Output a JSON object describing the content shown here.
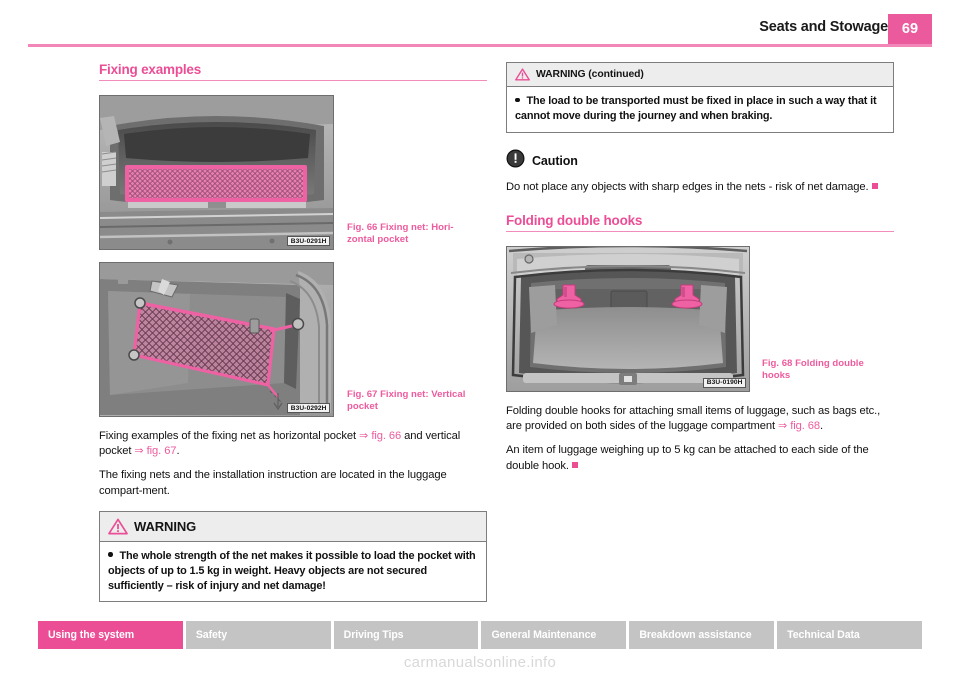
{
  "header": {
    "title": "Seats and Stowage",
    "page_number": "69",
    "accent_color": "#ec4e96"
  },
  "left_column": {
    "heading": "Fixing examples",
    "figures": [
      {
        "label": "Fig. 66",
        "caption": "Fixing net: Hori-\nzontal pocket",
        "caption_line1": "Fixing net: Hori-",
        "caption_line2": "zontal pocket",
        "watermark": "B3U-0291H",
        "alt": "Open car boot with pink fixing net stretched horizontally as a pocket"
      },
      {
        "label": "Fig. 67",
        "caption_line1": "Fixing net:",
        "caption_line2": "Vertical pocket",
        "watermark": "B3U-0292H",
        "alt": "Luggage compartment side wall with pink fixing net mounted as a vertical pocket"
      }
    ],
    "paragraphs": [
      {
        "segments": [
          {
            "text": "Fixing examples of the fixing net as horizontal pocket ",
            "style": "plain"
          },
          {
            "text": "⇒ fig. 66",
            "style": "xref"
          },
          {
            "text": " and vertical pocket ",
            "style": "plain"
          },
          {
            "text": "⇒ fig. 67",
            "style": "xref"
          },
          {
            "text": ".",
            "style": "plain"
          }
        ]
      },
      {
        "segments": [
          {
            "text": "The fixing nets and the installation instruction are located in the luggage compart-ment.",
            "style": "plain"
          }
        ]
      }
    ],
    "warning": {
      "icon": "warning-triangle-icon",
      "title": "WARNING",
      "bullet": "The whole strength of the net makes it possible to load the pocket with objects of up to 1.5 kg in weight. Heavy objects are not secured sufficiently – risk of injury and net damage!"
    }
  },
  "right_column": {
    "warning_continued": {
      "icon": "warning-triangle-icon",
      "title": "WARNING (continued)",
      "bullet": "The load to be transported must be fixed in place in such a way that it cannot move during the journey and when braking."
    },
    "caution": {
      "icon": "caution-circle-icon",
      "title": "Caution",
      "text": "Do not place any objects with sharp edges in the nets - risk of net damage."
    },
    "heading": "Folding double hooks",
    "figure": {
      "label": "Fig. 68",
      "caption_line1": "Folding double",
      "caption_line2": "hooks",
      "watermark": "B3U-0190H",
      "alt": "Boot interior with two pink folding double hooks on the side trims"
    },
    "paragraphs": [
      {
        "segments": [
          {
            "text": "Folding double hooks for attaching small items of luggage, such as bags etc., are provided on both sides of the luggage compartment ",
            "style": "plain"
          },
          {
            "text": "⇒ fig. 68",
            "style": "xref"
          },
          {
            "text": ".",
            "style": "plain"
          }
        ]
      },
      {
        "segments": [
          {
            "text": "An item of luggage weighing up to 5 kg can be attached to each side of the double hook.",
            "style": "plain"
          }
        ],
        "endmark": true
      }
    ]
  },
  "footer": {
    "tabs": [
      {
        "label": "Using the system",
        "active": true
      },
      {
        "label": "Safety",
        "active": false
      },
      {
        "label": "Driving Tips",
        "active": false
      },
      {
        "label": "General Maintenance",
        "active": false
      },
      {
        "label": "Breakdown assistance",
        "active": false
      },
      {
        "label": "Technical Data",
        "active": false
      }
    ]
  },
  "site_watermark": "carmanualsonline.info"
}
